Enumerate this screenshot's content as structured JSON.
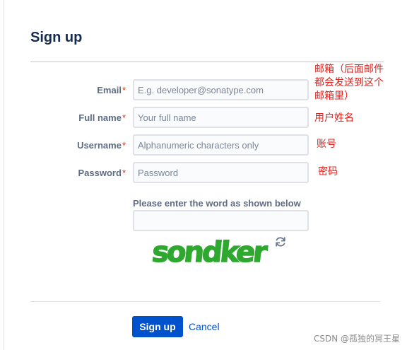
{
  "page": {
    "title": "Sign up"
  },
  "form": {
    "email": {
      "label": "Email",
      "required_mark": "*",
      "placeholder": "E.g. developer@sonatype.com",
      "value": ""
    },
    "full_name": {
      "label": "Full name",
      "required_mark": "*",
      "placeholder": "Your full name",
      "value": ""
    },
    "username": {
      "label": "Username",
      "required_mark": "*",
      "placeholder": "Alphanumeric characters only",
      "value": ""
    },
    "password": {
      "label": "Password",
      "required_mark": "*",
      "placeholder": "Password",
      "value": ""
    }
  },
  "captcha": {
    "prompt": "Please enter the word as shown below",
    "input_value": "",
    "word": "sondker",
    "word_color": "#2fa82f",
    "refresh_icon": "refresh-icon"
  },
  "actions": {
    "signup_label": "Sign up",
    "cancel_label": "Cancel"
  },
  "annotations": {
    "email_line1": "邮箱（后面邮件",
    "email_line2": "都会发送到这个",
    "email_line3": "邮箱里）",
    "full_name": "用户姓名",
    "username": "账号",
    "password": "密码"
  },
  "watermark": "CSDN @孤独的冥王星",
  "colors": {
    "accent": "#0052cc",
    "required": "#de350b",
    "annotation": "#e0201c"
  }
}
